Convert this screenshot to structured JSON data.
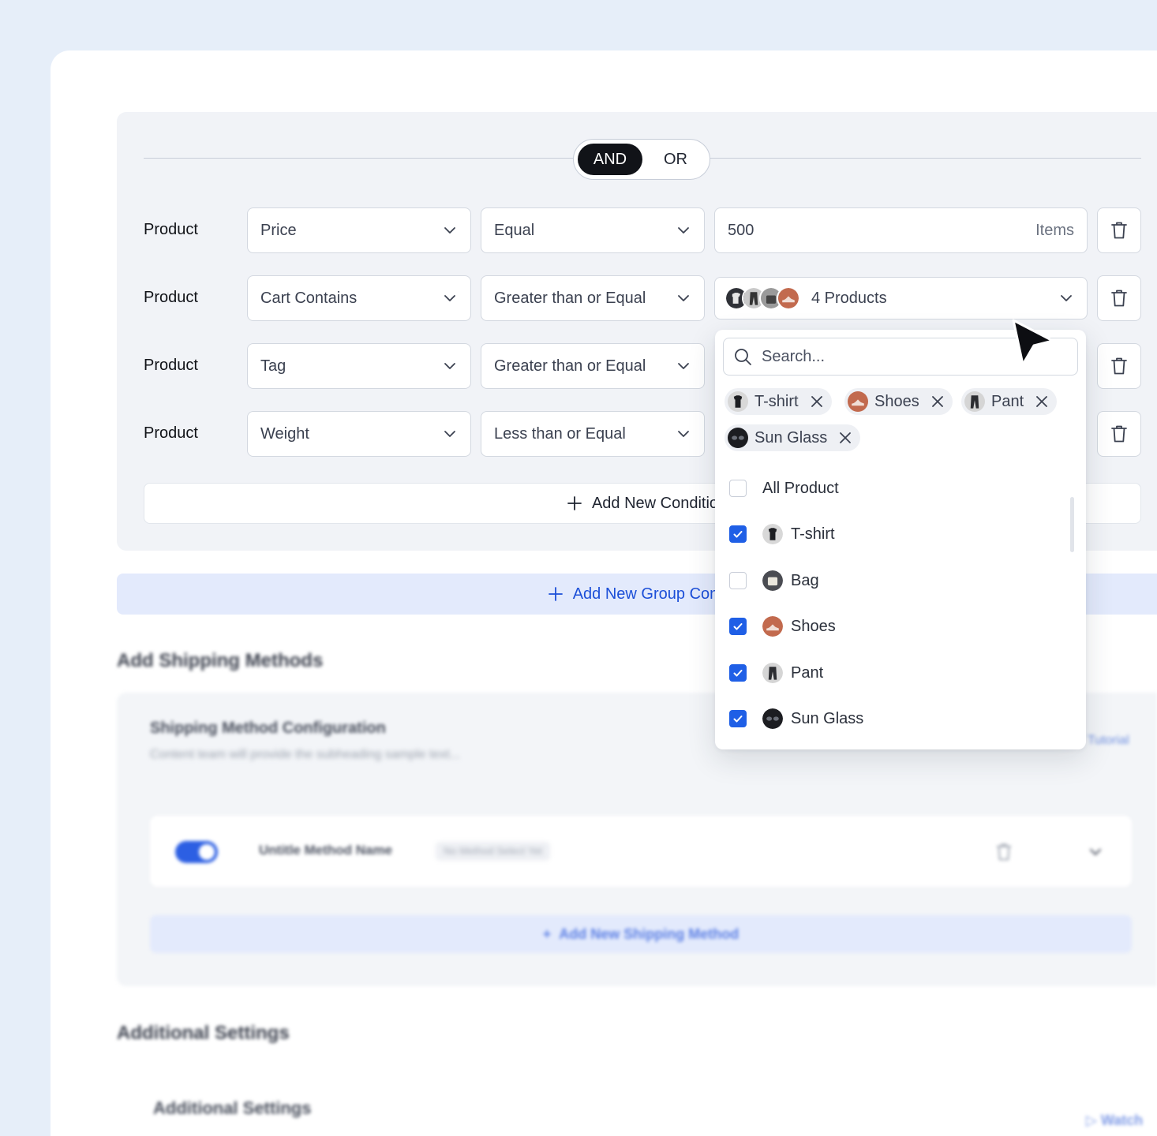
{
  "toggle": {
    "and_label": "AND",
    "or_label": "OR"
  },
  "rows": [
    {
      "label": "Product",
      "field": "Price",
      "operator": "Equal",
      "value": "500",
      "unit": "Items"
    },
    {
      "label": "Product",
      "field": "Cart Contains",
      "operator": "Greater than or Equal",
      "value_summary": "4 Products"
    },
    {
      "label": "Product",
      "field": "Tag",
      "operator": "Greater than or Equal"
    },
    {
      "label": "Product",
      "field": "Weight",
      "operator": "Less than or Equal"
    }
  ],
  "add_condition_label": "Add New Conditio",
  "add_group_label": "Add New Group Conc",
  "dropdown": {
    "search_placeholder": "Search...",
    "chips": [
      "T-shirt",
      "Shoes",
      "Pant",
      "Sun Glass"
    ],
    "options": [
      {
        "label": "All Product",
        "checked": false
      },
      {
        "label": "T-shirt",
        "checked": true,
        "icon": "tshirt-thumb"
      },
      {
        "label": "Bag",
        "checked": false,
        "icon": "bag-thumb"
      },
      {
        "label": "Shoes",
        "checked": true,
        "icon": "shoes-thumb"
      },
      {
        "label": "Pant",
        "checked": true,
        "icon": "pant-thumb"
      },
      {
        "label": "Sun Glass",
        "checked": true,
        "icon": "sunglass-thumb"
      }
    ]
  },
  "shipping": {
    "section_title": "Add Shipping Methods",
    "panel_title": "Shipping Method Configuration",
    "panel_subtitle": "Content team will provide the subheading sample text...",
    "tutorial_link": "Tutorial",
    "method_name": "Untitle Method Name",
    "method_badge": "No Method Select Yet",
    "add_method_label": "Add New Shipping Method"
  },
  "additional": {
    "section_title": "Additional Settings",
    "sub_title": "Additional Settings",
    "watch_label": "Watch"
  },
  "colors": {
    "accent": "#1f5fe6",
    "dark_toggle": "#111318",
    "panel_bg": "#f1f3f7",
    "page_bg": "#e6eef9"
  }
}
